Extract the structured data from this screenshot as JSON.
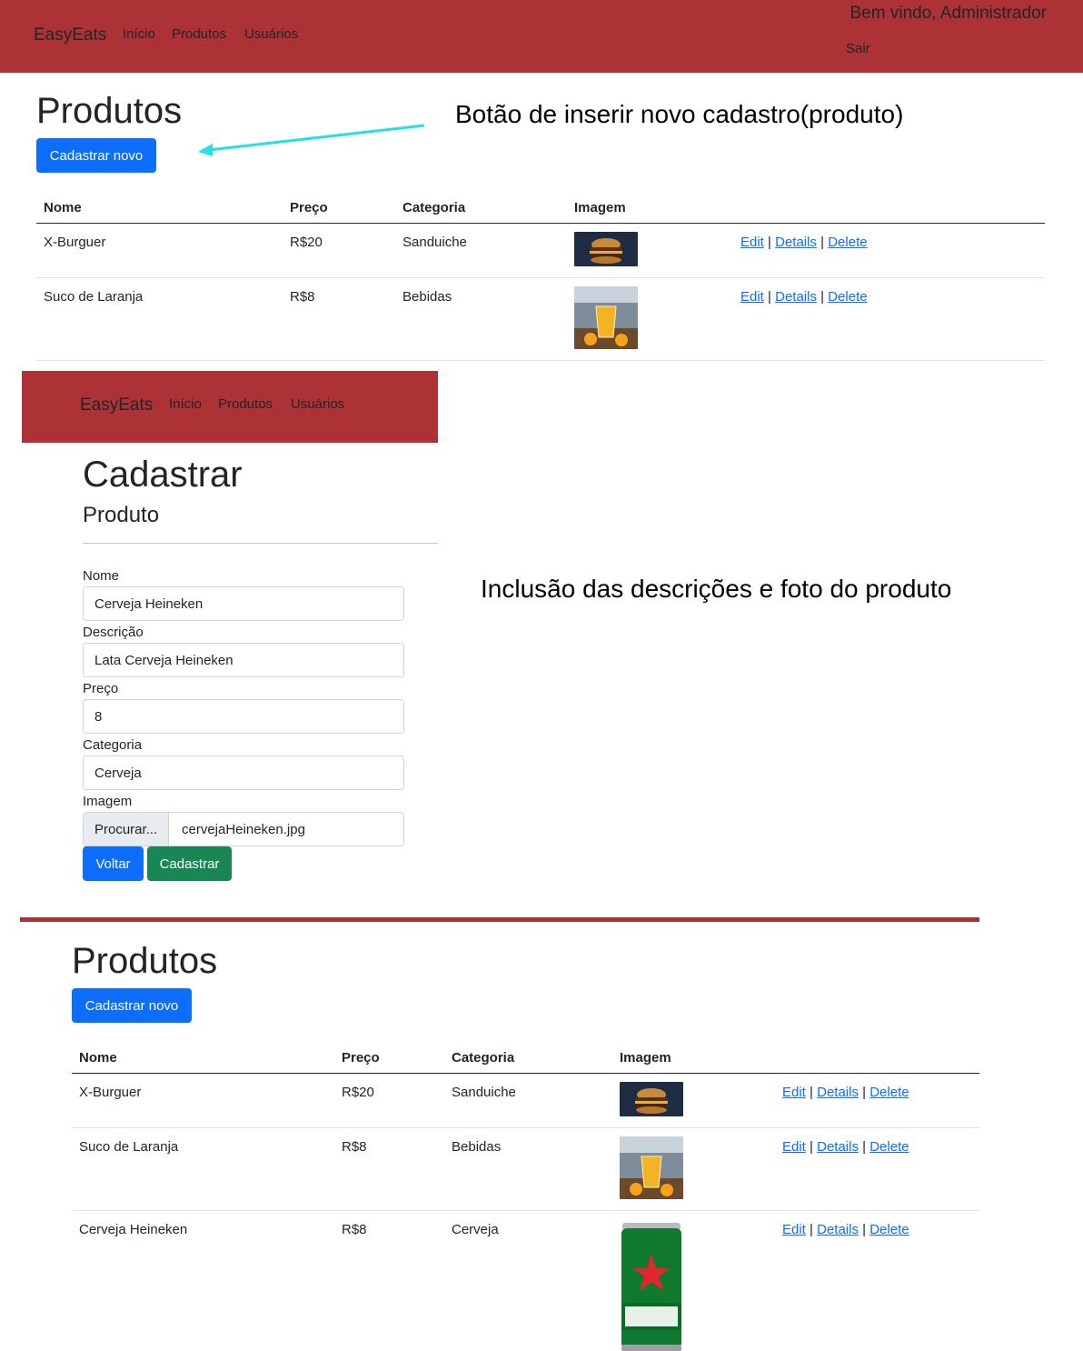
{
  "top_nav": {
    "brand": "EasyEats",
    "links": [
      "Início",
      "Produtos",
      "Usuários"
    ],
    "welcome": "Bem vindo, Administrador",
    "logout": "Sair"
  },
  "list1": {
    "title": "Produtos",
    "new_button": "Cadastrar novo",
    "headers": [
      "Nome",
      "Preço",
      "Categoria",
      "Imagem"
    ],
    "rows": [
      {
        "nome": "X-Burguer",
        "preco": "R$20",
        "categoria": "Sanduiche",
        "imagem": "burger-photo"
      },
      {
        "nome": "Suco de Laranja",
        "preco": "R$8",
        "categoria": "Bebidas",
        "imagem": "orange-juice-photo"
      }
    ],
    "actions": {
      "edit": "Edit",
      "details": "Details",
      "delete": "Delete",
      "sep": "|"
    }
  },
  "annotation1": "Botão de inserir novo cadastro(produto)",
  "form_nav": {
    "brand": "EasyEats",
    "links": [
      "Início",
      "Produtos",
      "Usuários"
    ]
  },
  "form": {
    "title": "Cadastrar",
    "subtitle": "Produto",
    "fields": {
      "nome": {
        "label": "Nome",
        "value": "Cerveja Heineken"
      },
      "descricao": {
        "label": "Descrição",
        "value": "Lata Cerveja Heineken"
      },
      "preco": {
        "label": "Preço",
        "value": "8"
      },
      "categoria": {
        "label": "Categoria",
        "value": "Cerveja"
      },
      "imagem": {
        "label": "Imagem",
        "browse": "Procurar...",
        "filename": "cervejaHeineken.jpg"
      }
    },
    "back_button": "Voltar",
    "submit_button": "Cadastrar"
  },
  "annotation2": "Inclusão das descrições e foto do produto",
  "list2": {
    "title": "Produtos",
    "new_button": "Cadastrar novo",
    "headers": [
      "Nome",
      "Preço",
      "Categoria",
      "Imagem"
    ],
    "rows": [
      {
        "nome": "X-Burguer",
        "preco": "R$20",
        "categoria": "Sanduiche",
        "imagem": "burger-photo"
      },
      {
        "nome": "Suco de Laranja",
        "preco": "R$8",
        "categoria": "Bebidas",
        "imagem": "orange-juice-photo"
      },
      {
        "nome": "Cerveja Heineken",
        "preco": "R$8",
        "categoria": "Cerveja",
        "imagem": "beer-can-photo"
      }
    ],
    "actions": {
      "edit": "Edit",
      "details": "Details",
      "delete": "Delete",
      "sep": "|"
    }
  },
  "colors": {
    "navbar": "#ad3236",
    "primary": "#0d6efd",
    "success": "#198754",
    "annotation_arrow": "#22e0e6"
  }
}
